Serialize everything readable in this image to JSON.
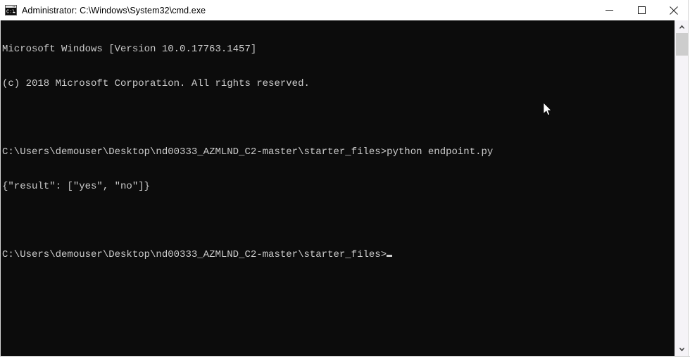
{
  "window": {
    "title": "Administrator: C:\\Windows\\System32\\cmd.exe",
    "icon": "cmd-console-icon",
    "titlebar_bg": "#ffffff",
    "console_bg": "#0c0c0c",
    "console_fg": "#cccccc"
  },
  "controls": {
    "minimize_label": "Minimize",
    "maximize_label": "Maximize",
    "close_label": "Close"
  },
  "terminal": {
    "lines": [
      "Microsoft Windows [Version 10.0.17763.1457]",
      "(c) 2018 Microsoft Corporation. All rights reserved.",
      "",
      "C:\\Users\\demouser\\Desktop\\nd00333_AZMLND_C2-master\\starter_files>python endpoint.py",
      "{\"result\": [\"yes\", \"no\"]}",
      "",
      "C:\\Users\\demouser\\Desktop\\nd00333_AZMLND_C2-master\\starter_files>"
    ],
    "header_line_1": "Microsoft Windows [Version 10.0.17763.1457]",
    "header_line_2": "(c) 2018 Microsoft Corporation. All rights reserved.",
    "prompt_path": "C:\\Users\\demouser\\Desktop\\nd00333_AZMLND_C2-master\\starter_files>",
    "command": "python endpoint.py",
    "output": "{\"result\": [\"yes\", \"no\"]}",
    "cursor_visible": "true"
  },
  "scrollbar": {
    "up_arrow": "scroll-up-arrow",
    "down_arrow": "scroll-down-arrow",
    "thumb_color": "#cdcdcd"
  }
}
